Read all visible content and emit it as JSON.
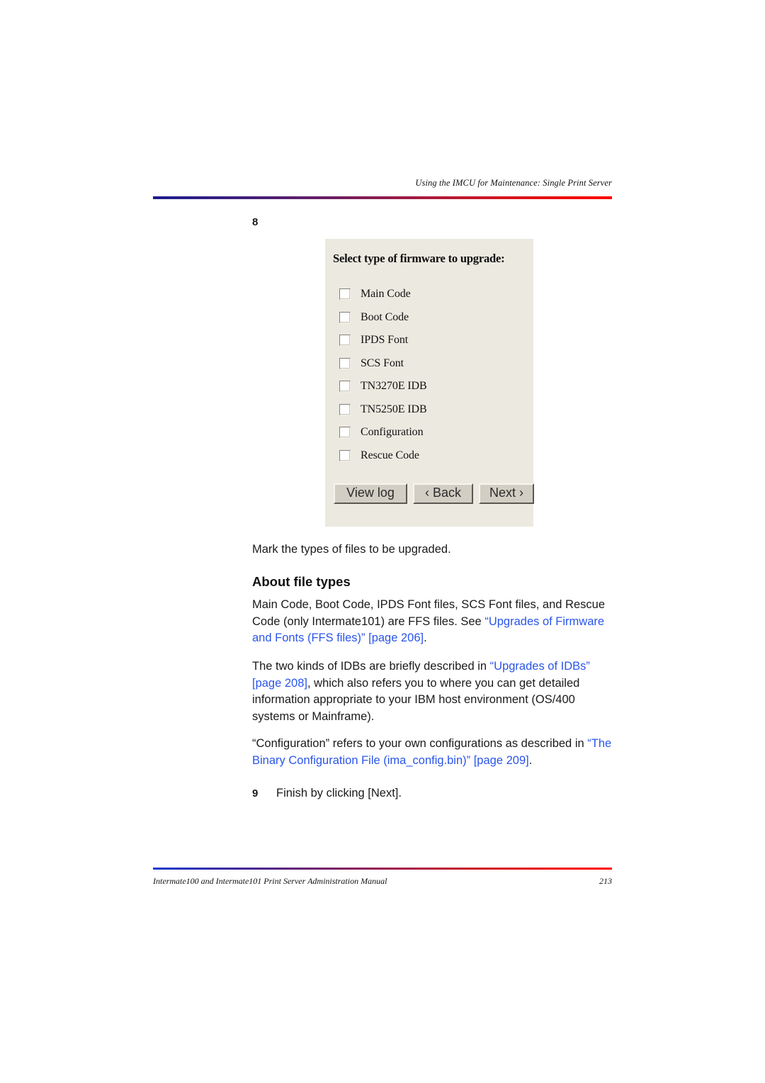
{
  "page": {
    "running_head": "Using the IMCU for Maintenance: Single Print Server",
    "footer_text": "Intermate100 and Intermate101 Print Server Administration Manual",
    "footer_page": "213",
    "rule_start_color": "#1c1c8c",
    "rule_end_color": "#ff0000"
  },
  "steps": {
    "step8_number": "8",
    "step8_caption": "Mark the types of files to be upgraded.",
    "step9_number": "9",
    "step9_text": "Finish by clicking [Next]."
  },
  "dialog": {
    "title": "Select type of firmware to upgrade:",
    "background_color": "#ece9e0",
    "checkboxes": [
      {
        "label": "Main Code",
        "checked": false
      },
      {
        "label": "Boot Code",
        "checked": false
      },
      {
        "label": "IPDS Font",
        "checked": false
      },
      {
        "label": "SCS Font",
        "checked": false
      },
      {
        "label": "TN3270E IDB",
        "checked": false
      },
      {
        "label": "TN5250E IDB",
        "checked": false
      },
      {
        "label": "Configuration",
        "checked": false
      },
      {
        "label": "Rescue Code",
        "checked": false
      }
    ],
    "buttons": {
      "view_log": "View log",
      "back": "‹ Back",
      "next": "Next ›"
    }
  },
  "section": {
    "heading": "About file types",
    "para1": {
      "lead": "Main Code, Boot Code, IPDS Font files, SCS Font files, and Rescue Code (only Intermate101) are FFS files. See ",
      "link": "“Upgrades of Firmware and Fonts (FFS files)” [page 206]",
      "tail": "."
    },
    "para2": {
      "lead": "The two kinds of IDBs are briefly described in ",
      "link": "“Upgrades of IDBs” [page 208]",
      "tail": ", which also refers you to where you can get detailed information appropriate to your IBM host environment (OS/400 systems or Mainframe)."
    },
    "para3": {
      "lead": "“Configuration” refers to your own configurations as described in ",
      "link": "“The Binary Configuration File (ima_config.bin)” [page 209]",
      "tail": "."
    },
    "link_color": "#2a55ea"
  }
}
